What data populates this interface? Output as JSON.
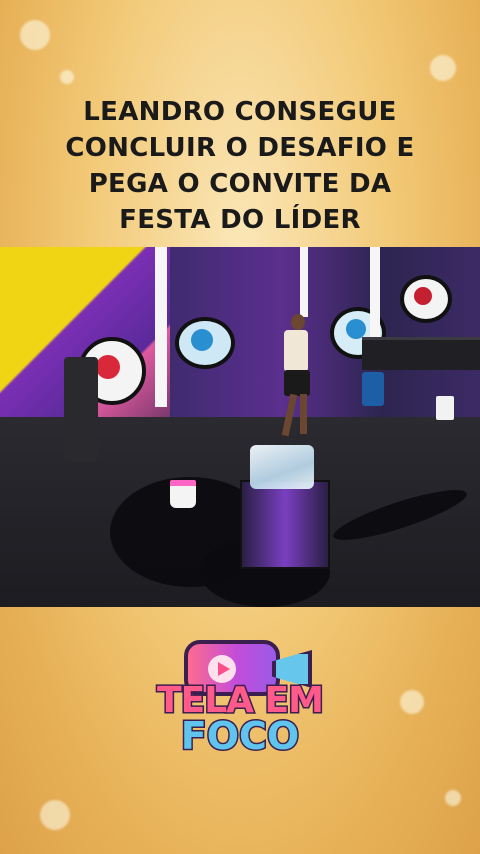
{
  "headline": {
    "lines": [
      "LEANDRO CONSEGUE",
      "CONCLUIR O DESAFIO E",
      "PEGA O CONVITE DA",
      "FESTA DO LÍDER"
    ]
  },
  "logo": {
    "line1": "TELA EM",
    "line2": "FOCO",
    "icon": "video-camera-play-icon"
  },
  "colors": {
    "background": "#f2c977",
    "headline_text": "#1a1a1a",
    "logo_pink": "#ff5a8a",
    "logo_blue": "#5fc4ee",
    "logo_outline": "#3a1f4f"
  }
}
